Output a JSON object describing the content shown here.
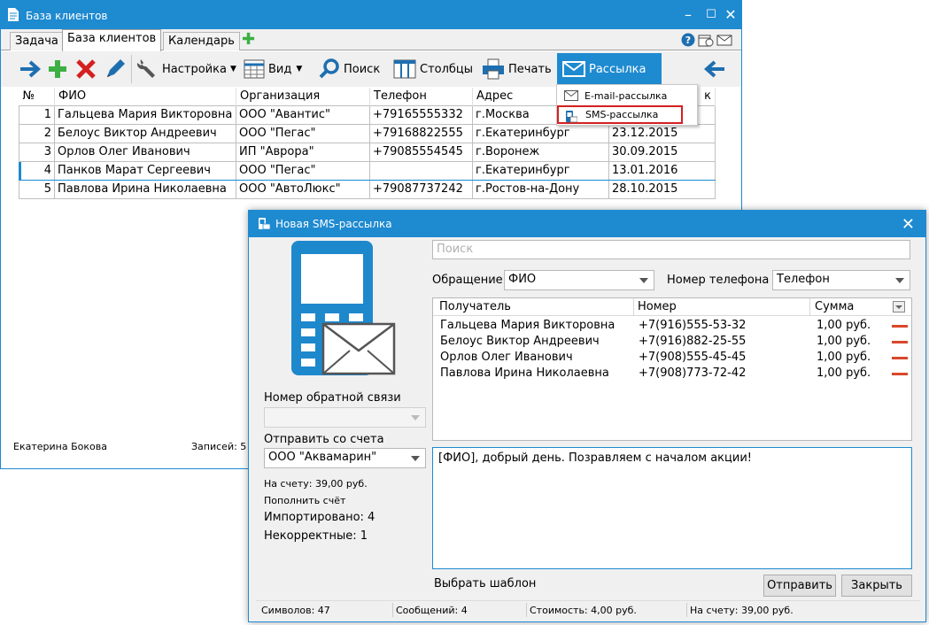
{
  "main_window": {
    "title": "База клиентов",
    "tabs": [
      "Задача",
      "База клиентов",
      "Календарь"
    ],
    "toolbar": {
      "settings": "Настройка",
      "view": "Вид",
      "search": "Поиск",
      "columns": "Столбцы",
      "print": "Печать",
      "mailing": "Рассылка"
    },
    "grid": {
      "headers": [
        "№",
        "ФИО",
        "Организация",
        "Телефон",
        "Адрес",
        "к"
      ],
      "rows": [
        {
          "n": "1",
          "fio": "Гальцева Мария Викторовна",
          "org": "ООО \"Авантис\"",
          "phone": "+79165555332",
          "addr": "г.Москва",
          "date": ""
        },
        {
          "n": "2",
          "fio": "Белоус Виктор Андреевич",
          "org": "ООО \"Пегас\"",
          "phone": "+79168822555",
          "addr": "г.Екатеринбург",
          "date": "23.12.2015"
        },
        {
          "n": "3",
          "fio": "Орлов Олег Иванович",
          "org": "ИП \"Аврора\"",
          "phone": "+79085554545",
          "addr": "г.Воронеж",
          "date": "30.09.2015"
        },
        {
          "n": "4",
          "fio": "Панков Марат Сергеевич",
          "org": "ООО \"Пегас\"",
          "phone": "",
          "addr": "г.Екатеринбург",
          "date": "13.01.2016"
        },
        {
          "n": "5",
          "fio": "Павлова Ирина Николаевна",
          "org": "ООО \"АвтоЛюкс\"",
          "phone": "+79087737242",
          "addr": "г.Ростов-на-Дону",
          "date": "28.10.2015"
        }
      ]
    },
    "status": {
      "user": "Екатерина Бокова",
      "records": "Записей: 5"
    },
    "dropdown": {
      "email": "E-mail-рассылка",
      "sms": "SMS-рассылка"
    }
  },
  "dialog": {
    "title": "Новая SMS-рассылка",
    "search_placeholder": "Поиск",
    "salutation_label": "Обращение",
    "salutation_value": "ФИО",
    "phone_label": "Номер телефона",
    "phone_value": "Телефон",
    "callback_label": "Номер обратной связи",
    "send_from_label": "Отправить со счета",
    "send_from_value": "ООО \"Аквамарин\"",
    "balance": "На счету: 39,00 руб.",
    "topup": "Пополнить счёт",
    "imported": "Импортировано: 4",
    "invalid": "Некорректные: 1",
    "recipients_headers": {
      "recipient": "Получатель",
      "number": "Номер",
      "sum": "Сумма"
    },
    "recipients": [
      {
        "name": "Гальцева Мария Викторовна",
        "number": "+7(916)555-53-32",
        "sum": "1,00 руб."
      },
      {
        "name": "Белоус Виктор Андреевич",
        "number": "+7(916)882-25-55",
        "sum": "1,00 руб."
      },
      {
        "name": "Орлов Олег Иванович",
        "number": "+7(908)555-45-45",
        "sum": "1,00 руб."
      },
      {
        "name": "Павлова Ирина Николаевна",
        "number": "+7(908)773-72-42",
        "sum": "1,00 руб."
      }
    ],
    "message": "[ФИО], добрый день. Позравляем с началом акции!",
    "template_link": "Выбрать шаблон",
    "send_button": "Отправить",
    "close_button": "Закрыть",
    "status": {
      "chars": "Символов: 47",
      "messages": "Сообщений: 4",
      "cost": "Стоимость: 4,00 руб.",
      "balance": "На счету: 39,00 руб."
    }
  },
  "colors": {
    "accent": "#1e8ad0",
    "highlight_border": "#d42020",
    "remove": "#d9472b",
    "add": "#3cb043"
  }
}
